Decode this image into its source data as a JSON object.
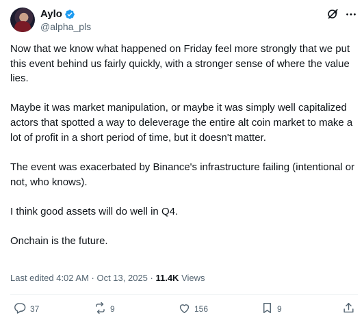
{
  "author": {
    "display_name": "Aylo",
    "handle": "@alpha_pls"
  },
  "post": {
    "paragraphs": [
      "Now that we know what happened on Friday feel more strongly that we put this event behind us fairly quickly, with a stronger sense of where the value lies.",
      "Maybe it was market manipulation, or maybe it was simply well capitalized actors that spotted a way to deleverage the entire alt coin market to make a lot of profit in a short period of time, but it doesn't matter.",
      "The event was exacerbated by Binance's infrastructure failing (intentional or not, who knows).",
      "I think good assets will do well in Q4.",
      "Onchain is the future."
    ]
  },
  "meta": {
    "edited_prefix": "Last edited 4:02 AM · Oct 13, 2025 · ",
    "views_count": "11.4K",
    "views_label": " Views"
  },
  "actions": {
    "replies": "37",
    "reposts": "9",
    "likes": "156",
    "bookmarks": "9"
  },
  "icons": [
    "verified-badge-icon",
    "grok-icon",
    "more-icon",
    "reply-icon",
    "repost-icon",
    "like-icon",
    "bookmark-icon",
    "share-icon"
  ],
  "colors": {
    "text": "#0f1419",
    "secondary": "#536471",
    "verified": "#1d9bf0",
    "divider": "#eff3f4"
  }
}
